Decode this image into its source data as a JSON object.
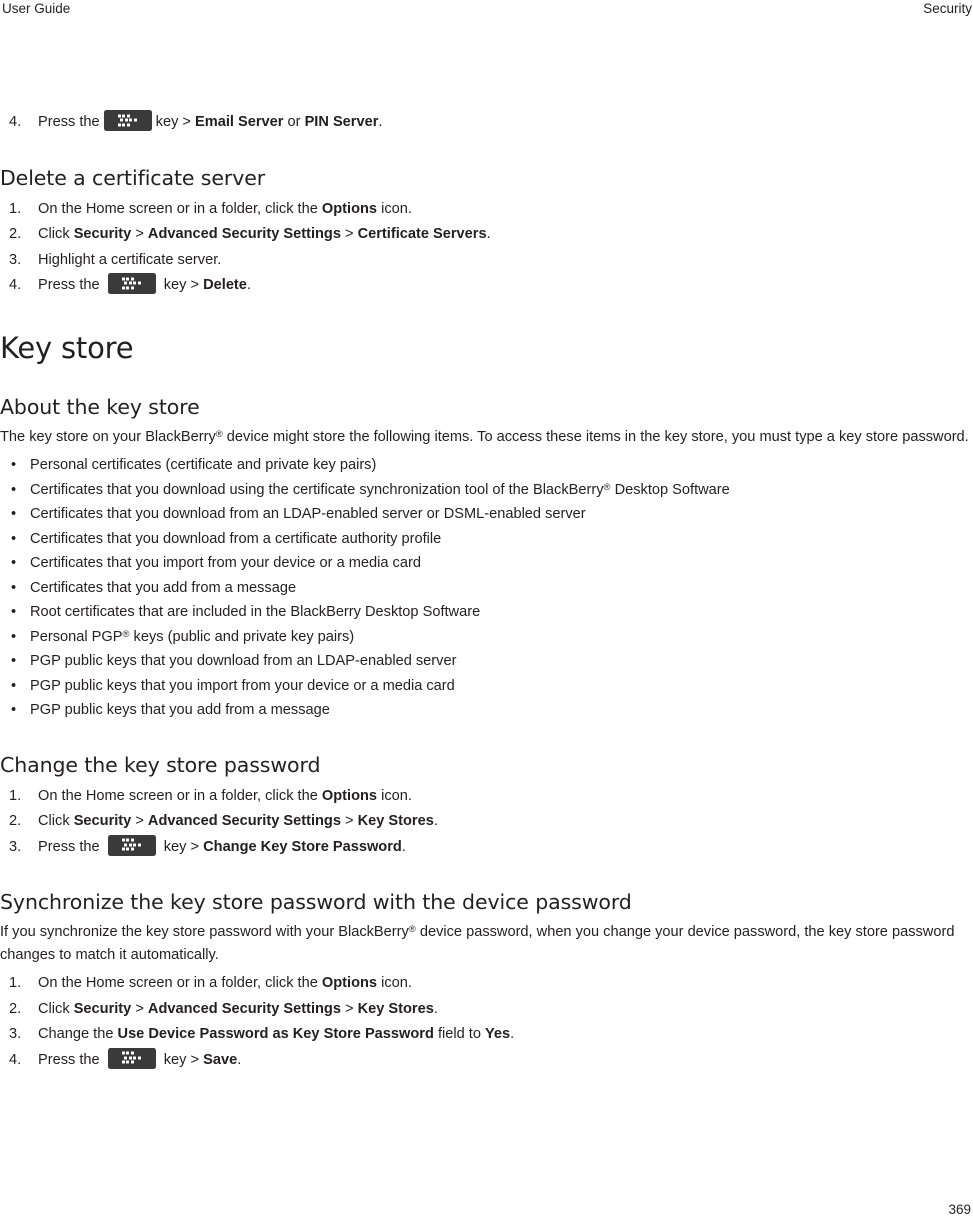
{
  "header": {
    "left": "User Guide",
    "right": "Security"
  },
  "footer": {
    "page_number": "369"
  },
  "icons": {
    "menu_key": "blackberry-menu-key-icon"
  },
  "colors": {
    "text": "#231f20",
    "key_icon_bg": "#3a3a3a",
    "key_icon_dots": "#ffffff",
    "page_bg": "#ffffff"
  },
  "orphan_step": {
    "number": "4.",
    "pre": "Press the",
    "post_a": "key >",
    "bold_a": "Email Server",
    "mid": "or",
    "bold_b": "PIN Server",
    "tail": "."
  },
  "sections": [
    {
      "id": "delete-a-certificate-server",
      "level": "h2",
      "heading": "Delete a certificate server",
      "steps": [
        {
          "number": "1.",
          "text_html": "On the Home screen or in a folder, click the <b>Options</b> icon."
        },
        {
          "number": "2.",
          "text_html": "Click <b>Security</b> > <b>Advanced Security Settings</b> > <b>Certificate Servers</b>."
        },
        {
          "number": "3.",
          "text_html": "Highlight a certificate server."
        },
        {
          "number": "4.",
          "text_html": "Press the {KEY} key > <b>Delete</b>."
        }
      ]
    },
    {
      "id": "key-store",
      "level": "h1",
      "heading": "Key store"
    },
    {
      "id": "about-the-key-store",
      "level": "h2",
      "heading": "About the key store",
      "paragraph_html": "The key store on your BlackBerry<sup class=\"reg\">®</sup> device might store the following items. To access these items in the key store, you must type a key store password.",
      "bullets": [
        "Personal certificates (certificate and private key pairs)",
        "Certificates that you download using the certificate synchronization tool of the BlackBerry<sup class=\"reg\">®</sup> Desktop Software",
        "Certificates that you download from an LDAP-enabled server or DSML-enabled server",
        "Certificates that you download from a certificate authority profile",
        "Certificates that you import from your device or a media card",
        "Certificates that you add from a message",
        "Root certificates that are included in the BlackBerry Desktop Software",
        "Personal PGP<sup class=\"reg\">®</sup> keys (public and private key pairs)",
        "PGP public keys that you download from an LDAP-enabled server",
        "PGP public keys that you import from your device or a media card",
        "PGP public keys that you add from a message"
      ]
    },
    {
      "id": "change-the-key-store-password",
      "level": "h2",
      "heading": "Change the key store password",
      "steps": [
        {
          "number": "1.",
          "text_html": "On the Home screen or in a folder, click the <b>Options</b> icon."
        },
        {
          "number": "2.",
          "text_html": "Click <b>Security</b> > <b>Advanced Security Settings</b> > <b>Key Stores</b>."
        },
        {
          "number": "3.",
          "text_html": "Press the {KEY} key > <b>Change Key Store Password</b>."
        }
      ]
    },
    {
      "id": "synchronize-the-key-store-password-with-the-device-password",
      "level": "h2",
      "heading": "Synchronize the key store password with the device password",
      "paragraph_html": "If you synchronize the key store password with your BlackBerry<sup class=\"reg\">®</sup> device password, when you change your device password, the key store password changes to match it automatically.",
      "steps": [
        {
          "number": "1.",
          "text_html": "On the Home screen or in a folder, click the <b>Options</b> icon."
        },
        {
          "number": "2.",
          "text_html": "Click <b>Security</b> > <b>Advanced Security Settings</b> > <b>Key Stores</b>."
        },
        {
          "number": "3.",
          "text_html": "Change the <b>Use Device Password as Key Store Password</b> field to <b>Yes</b>."
        },
        {
          "number": "4.",
          "text_html": "Press the {KEY} key > <b>Save</b>."
        }
      ]
    }
  ]
}
